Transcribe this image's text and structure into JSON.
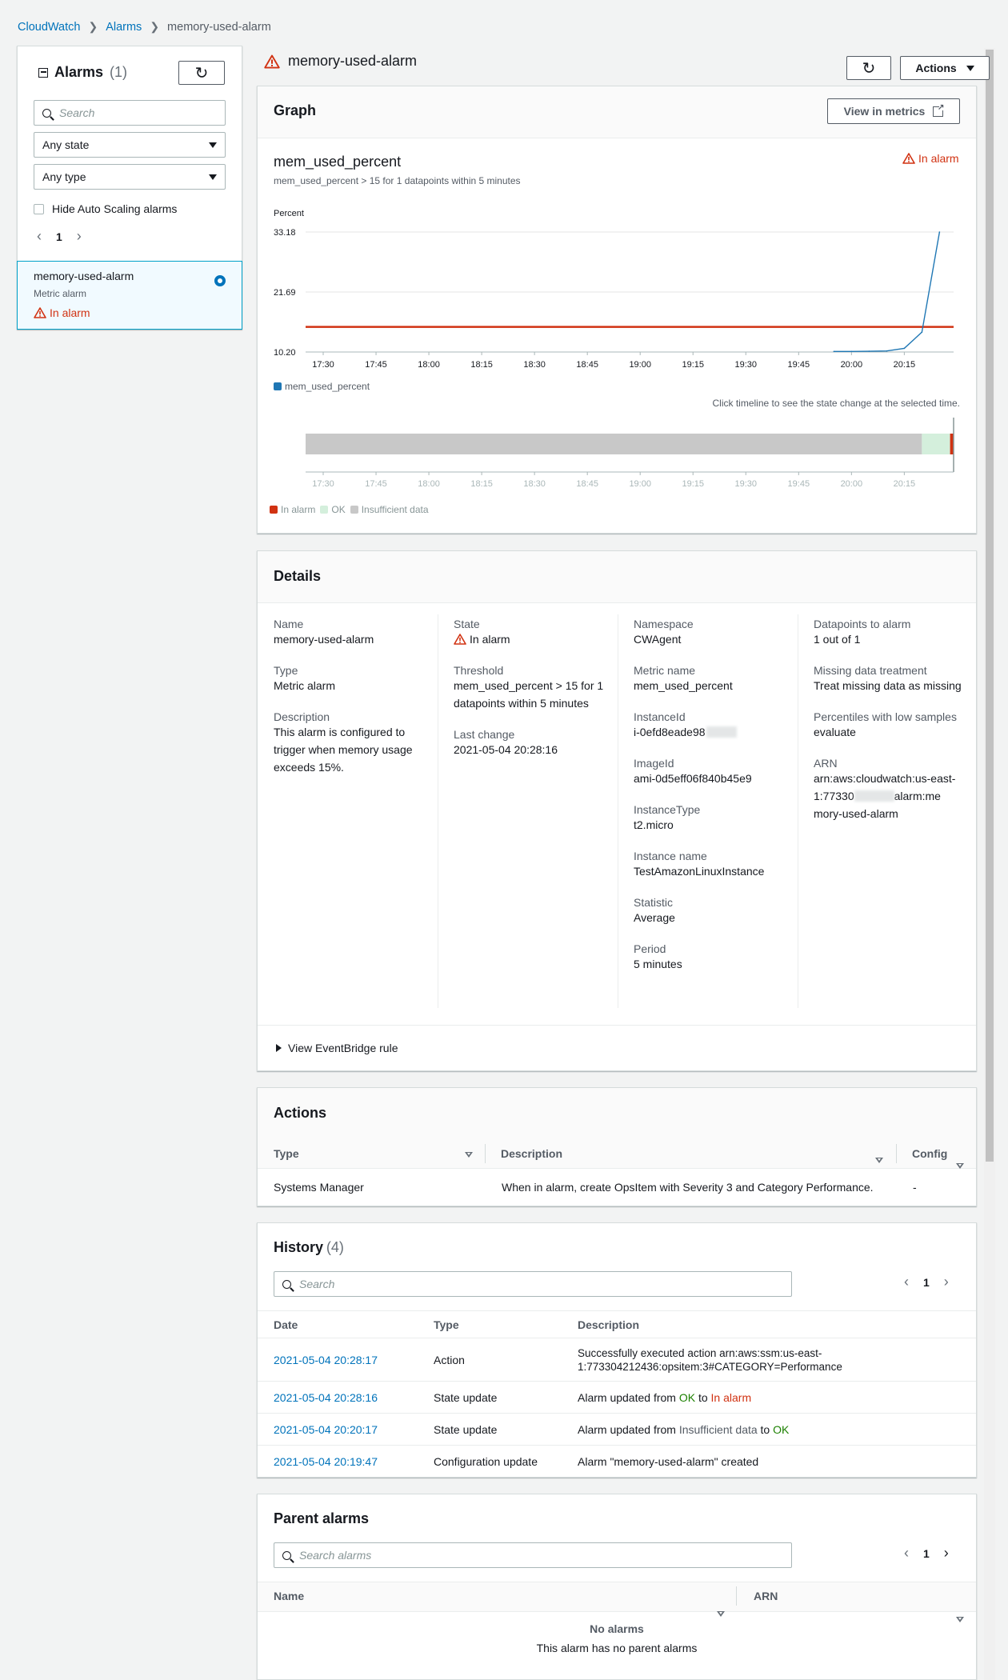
{
  "breadcrumb": {
    "root": "CloudWatch",
    "mid": "Alarms",
    "current": "memory-used-alarm"
  },
  "sidebar": {
    "title": "Alarms",
    "count": "(1)",
    "search_placeholder": "Search",
    "state_select": "Any state",
    "type_select": "Any type",
    "hide_autoscaling": "Hide Auto Scaling alarms",
    "page": "1",
    "alarm": {
      "name": "memory-used-alarm",
      "type": "Metric alarm",
      "state": "In alarm"
    }
  },
  "main": {
    "title": "memory-used-alarm",
    "actions_label": "Actions"
  },
  "graph": {
    "title": "Graph",
    "view_in_metrics": "View in metrics",
    "metric": "mem_used_percent",
    "condition": "mem_used_percent > 15 for 1 datapoints within 5 minutes",
    "state": "In alarm",
    "timeline_hint": "Click timeline to see the state change at the selected time.",
    "legend_in_alarm": "In alarm",
    "legend_ok": "OK",
    "legend_insufficient": "Insufficient data"
  },
  "chart_data": {
    "type": "line",
    "ylabel": "Percent",
    "yticks": [
      "33.18",
      "21.69",
      "10.20"
    ],
    "ylim": [
      10.2,
      33.18
    ],
    "categories": [
      "17:30",
      "17:45",
      "18:00",
      "18:15",
      "18:30",
      "18:45",
      "19:00",
      "19:15",
      "19:30",
      "19:45",
      "20:00",
      "20:15"
    ],
    "threshold": 15,
    "series": [
      {
        "name": "mem_used_percent",
        "color": "#1f77b4",
        "x": [
          "19:55",
          "20:00",
          "20:05",
          "20:10",
          "20:15",
          "20:20",
          "20:25"
        ],
        "values": [
          10.3,
          10.3,
          10.35,
          10.4,
          10.9,
          14.0,
          33.18
        ]
      }
    ],
    "state_timeline": [
      {
        "state": "Insufficient data",
        "color": "#c8c8c8",
        "from": "17:25",
        "to": "20:20"
      },
      {
        "state": "OK",
        "color": "#d4efdc",
        "from": "20:20",
        "to": "20:28"
      },
      {
        "state": "In alarm",
        "color": "#d13212",
        "from": "20:28",
        "to": "20:29"
      }
    ]
  },
  "details": {
    "title": "Details",
    "col1": [
      {
        "label": "Name",
        "value": "memory-used-alarm"
      },
      {
        "label": "Type",
        "value": "Metric alarm"
      },
      {
        "label": "Description",
        "value": "This alarm is configured to trigger when memory usage exceeds 15%."
      }
    ],
    "state_label": "State",
    "state_value": "In alarm",
    "threshold_label": "Threshold",
    "threshold_value": "mem_used_percent > 15 for 1 datapoints within 5 minutes",
    "last_change_label": "Last change",
    "last_change_value": "2021-05-04 20:28:16",
    "col3": [
      {
        "label": "Namespace",
        "value": "CWAgent"
      },
      {
        "label": "Metric name",
        "value": "mem_used_percent"
      },
      {
        "label": "InstanceId",
        "value": "i-0efd8eade98"
      },
      {
        "label": "ImageId",
        "value": "ami-0d5eff06f840b45e9"
      },
      {
        "label": "InstanceType",
        "value": "t2.micro"
      },
      {
        "label": "Instance name",
        "value": "TestAmazonLinuxInstance"
      },
      {
        "label": "Statistic",
        "value": "Average"
      },
      {
        "label": "Period",
        "value": "5 minutes"
      }
    ],
    "col4": [
      {
        "label": "Datapoints to alarm",
        "value": "1 out of 1"
      },
      {
        "label": "Missing data treatment",
        "value": "Treat missing data as missing"
      },
      {
        "label": "Percentiles with low samples",
        "value": "evaluate"
      }
    ],
    "arn_label": "ARN",
    "arn_line1": "arn:aws:cloudwatch:us-east-",
    "arn_line2a": "1:77330",
    "arn_line2b": "alarm:me",
    "arn_line3": "mory-used-alarm",
    "eventbridge": "View EventBridge rule"
  },
  "actions": {
    "title": "Actions",
    "headers": [
      "Type",
      "Description",
      "Config"
    ],
    "row": {
      "type": "Systems Manager",
      "description": "When in alarm, create OpsItem with Severity 3 and Category Performance.",
      "config": "-"
    }
  },
  "history": {
    "title": "History",
    "count": "(4)",
    "search_placeholder": "Search",
    "page": "1",
    "headers": [
      "Date",
      "Type",
      "Description"
    ],
    "rows": [
      {
        "date": "2021-05-04 20:28:17",
        "type": "Action",
        "desc1": "Successfully executed action arn:aws:ssm:us-east-",
        "desc2": "1:773304212436:opsitem:3#CATEGORY=Performance"
      },
      {
        "date": "2021-05-04 20:28:16",
        "type": "State update",
        "pre": "Alarm updated from ",
        "from": "OK",
        "mid": " to ",
        "to": "In alarm"
      },
      {
        "date": "2021-05-04 20:20:17",
        "type": "State update",
        "pre": "Alarm updated from ",
        "from": "Insufficient data",
        "mid": " to ",
        "to": "OK"
      },
      {
        "date": "2021-05-04 20:19:47",
        "type": "Configuration update",
        "desc": "Alarm \"memory-used-alarm\" created"
      }
    ]
  },
  "parent_alarms": {
    "title": "Parent alarms",
    "search_placeholder": "Search alarms",
    "page": "1",
    "headers": [
      "Name",
      "ARN"
    ],
    "empty_title": "No alarms",
    "empty_desc": "This alarm has no parent alarms"
  },
  "colors": {
    "link": "#0073bb",
    "alarm_red": "#d13212",
    "ok_green": "#1d8102",
    "series_blue": "#1f77b4"
  }
}
